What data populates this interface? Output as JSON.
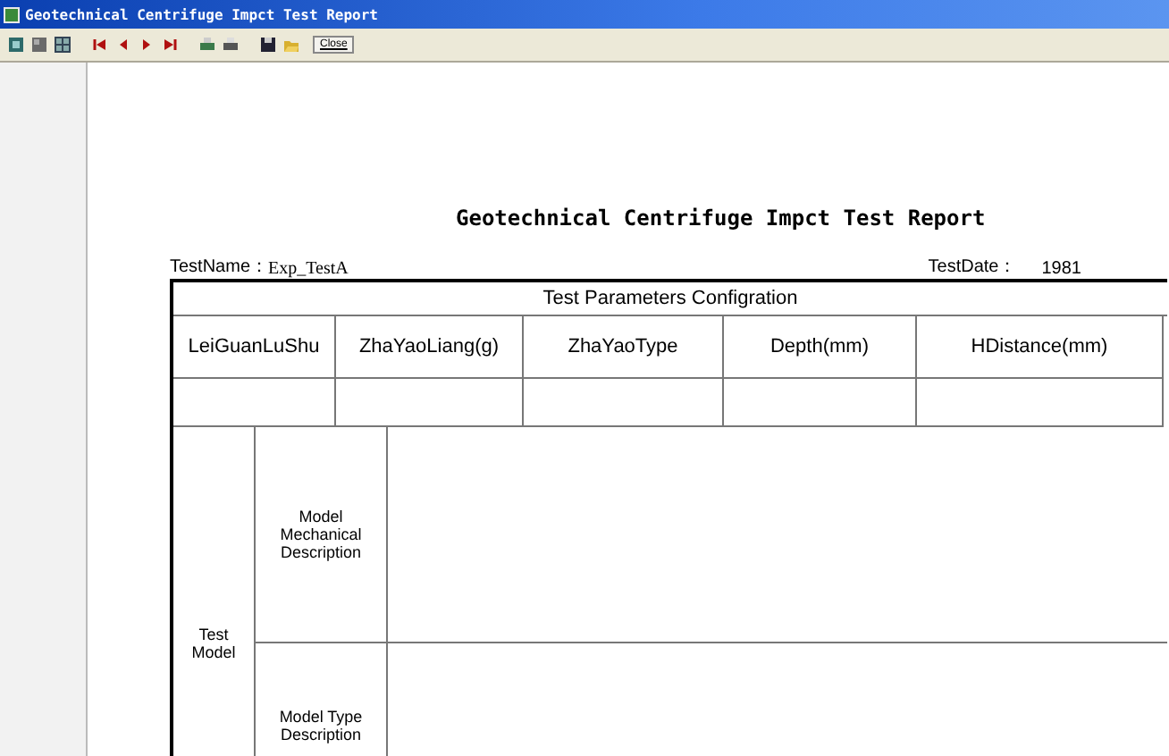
{
  "window": {
    "title": "Geotechnical Centrifuge Impct Test Report"
  },
  "toolbar": {
    "close_button": "Close"
  },
  "report": {
    "title": "Geotechnical Centrifuge Impct Test Report",
    "test_name_label": "TestName：",
    "test_name": "Exp_TestA",
    "test_date_label": "TestDate：",
    "test_date": "1981",
    "table": {
      "title": "Test Parameters Configration",
      "columns": [
        "LeiGuanLuShu",
        "ZhaYaoLiang(g)",
        "ZhaYaoType",
        "Depth(mm)",
        "HDistance(mm)"
      ],
      "sections": [
        {
          "label": "Test Model",
          "rows": [
            {
              "label": "Model Mechanical Description"
            },
            {
              "label": "Model Type Description"
            }
          ]
        }
      ]
    }
  }
}
